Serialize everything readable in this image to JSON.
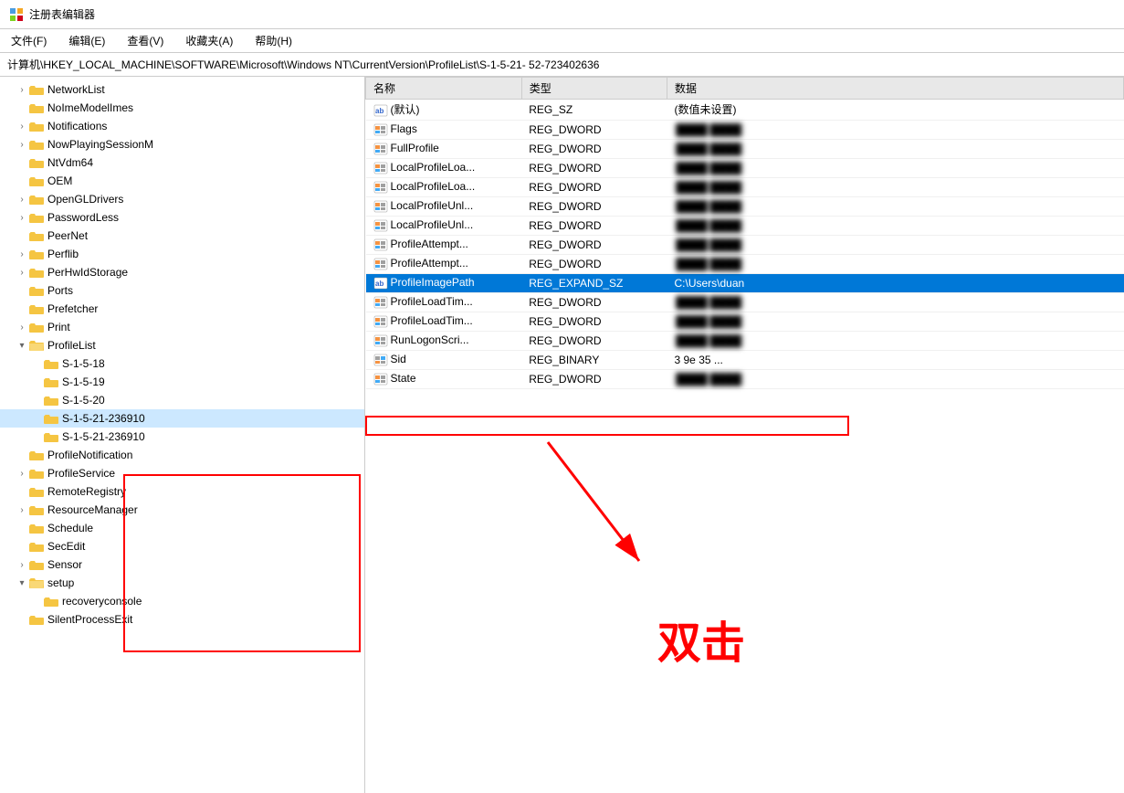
{
  "window": {
    "title": "注册表编辑器"
  },
  "menu": {
    "items": [
      "文件(F)",
      "编辑(E)",
      "查看(V)",
      "收藏夹(A)",
      "帮助(H)"
    ]
  },
  "address": {
    "path": "计算机\\HKEY_LOCAL_MACHINE\\SOFTWARE\\Microsoft\\Windows NT\\CurrentVersion\\ProfileList\\S-1-5-21-                    52-723402636"
  },
  "tree": {
    "items": [
      {
        "id": "networkList",
        "label": "NetworkList",
        "indent": 1,
        "expanded": false,
        "hasChildren": true
      },
      {
        "id": "noImeModelImes",
        "label": "NoImeModelImes",
        "indent": 1,
        "expanded": false,
        "hasChildren": false
      },
      {
        "id": "notifications",
        "label": "Notifications",
        "indent": 1,
        "expanded": false,
        "hasChildren": true
      },
      {
        "id": "nowPlayingSessionM",
        "label": "NowPlayingSessionM",
        "indent": 1,
        "expanded": false,
        "hasChildren": true
      },
      {
        "id": "ntVdm64",
        "label": "NtVdm64",
        "indent": 1,
        "expanded": false,
        "hasChildren": false
      },
      {
        "id": "oem",
        "label": "OEM",
        "indent": 1,
        "expanded": false,
        "hasChildren": false
      },
      {
        "id": "openGLDrivers",
        "label": "OpenGLDrivers",
        "indent": 1,
        "expanded": false,
        "hasChildren": true
      },
      {
        "id": "passwordLess",
        "label": "PasswordLess",
        "indent": 1,
        "expanded": false,
        "hasChildren": true
      },
      {
        "id": "peerNet",
        "label": "PeerNet",
        "indent": 1,
        "expanded": false,
        "hasChildren": false
      },
      {
        "id": "perflib",
        "label": "Perflib",
        "indent": 1,
        "expanded": false,
        "hasChildren": true
      },
      {
        "id": "perHwIdStorage",
        "label": "PerHwIdStorage",
        "indent": 1,
        "expanded": false,
        "hasChildren": true
      },
      {
        "id": "ports",
        "label": "Ports",
        "indent": 1,
        "expanded": false,
        "hasChildren": false
      },
      {
        "id": "prefetcher",
        "label": "Prefetcher",
        "indent": 1,
        "expanded": false,
        "hasChildren": false
      },
      {
        "id": "print",
        "label": "Print",
        "indent": 1,
        "expanded": false,
        "hasChildren": true
      },
      {
        "id": "profileList",
        "label": "ProfileList",
        "indent": 1,
        "expanded": true,
        "hasChildren": true,
        "boxed": true
      },
      {
        "id": "s1518",
        "label": "S-1-5-18",
        "indent": 2,
        "expanded": false,
        "hasChildren": false
      },
      {
        "id": "s1519",
        "label": "S-1-5-19",
        "indent": 2,
        "expanded": false,
        "hasChildren": false
      },
      {
        "id": "s1520",
        "label": "S-1-5-20",
        "indent": 2,
        "expanded": false,
        "hasChildren": false
      },
      {
        "id": "s152121",
        "label": "S-1-5-21-236910",
        "indent": 2,
        "expanded": false,
        "hasChildren": false,
        "selected": true
      },
      {
        "id": "s152122",
        "label": "S-1-5-21-236910",
        "indent": 2,
        "expanded": false,
        "hasChildren": false
      },
      {
        "id": "profileNotification",
        "label": "ProfileNotification",
        "indent": 1,
        "expanded": false,
        "hasChildren": false
      },
      {
        "id": "profileService",
        "label": "ProfileService",
        "indent": 1,
        "expanded": false,
        "hasChildren": true
      },
      {
        "id": "remoteRegistry",
        "label": "RemoteRegistry",
        "indent": 1,
        "expanded": false,
        "hasChildren": false
      },
      {
        "id": "resourceManager",
        "label": "ResourceManager",
        "indent": 1,
        "expanded": false,
        "hasChildren": true
      },
      {
        "id": "schedule",
        "label": "Schedule",
        "indent": 1,
        "expanded": false,
        "hasChildren": false
      },
      {
        "id": "secEdit",
        "label": "SecEdit",
        "indent": 1,
        "expanded": false,
        "hasChildren": false
      },
      {
        "id": "sensor",
        "label": "Sensor",
        "indent": 1,
        "expanded": false,
        "hasChildren": true
      },
      {
        "id": "setup",
        "label": "setup",
        "indent": 1,
        "expanded": true,
        "hasChildren": true
      },
      {
        "id": "recoveryConsole",
        "label": "recoveryconsole",
        "indent": 2,
        "expanded": false,
        "hasChildren": false
      },
      {
        "id": "silentProcessExit",
        "label": "SilentProcessExit",
        "indent": 1,
        "expanded": false,
        "hasChildren": false
      }
    ]
  },
  "table": {
    "columns": [
      "名称",
      "类型",
      "数据"
    ],
    "rows": [
      {
        "name": "(默认)",
        "type": "REG_SZ",
        "data": "(数值未设置)",
        "icon": "ab",
        "highlighted": false
      },
      {
        "name": "Flags",
        "type": "REG_DWORD",
        "data": "BLURRED_0",
        "icon": "dword",
        "highlighted": false
      },
      {
        "name": "FullProfile",
        "type": "REG_DWORD",
        "data": "BLURRED_1",
        "icon": "dword",
        "highlighted": false
      },
      {
        "name": "LocalProfileLoa...",
        "type": "REG_DWORD",
        "data": "BLURRED_2",
        "icon": "dword",
        "highlighted": false
      },
      {
        "name": "LocalProfileLoa...",
        "type": "REG_DWORD",
        "data": "BLURRED_3",
        "icon": "dword",
        "highlighted": false
      },
      {
        "name": "LocalProfileUnl...",
        "type": "REG_DWORD",
        "data": "BLURRED_4",
        "icon": "dword",
        "highlighted": false
      },
      {
        "name": "LocalProfileUnl...",
        "type": "REG_DWORD",
        "data": "BLURRED_5",
        "icon": "dword",
        "highlighted": false
      },
      {
        "name": "ProfileAttempt...",
        "type": "REG_DWORD",
        "data": "BLURRED_6",
        "icon": "dword",
        "highlighted": false
      },
      {
        "name": "ProfileAttempt...",
        "type": "REG_DWORD",
        "data": "BLURRED_7",
        "icon": "dword",
        "highlighted": false
      },
      {
        "name": "ProfileImagePath",
        "type": "REG_EXPAND_SZ",
        "data": "C:\\Users\\duan",
        "icon": "ab",
        "highlighted": true,
        "selected": true
      },
      {
        "name": "ProfileLoadTim...",
        "type": "REG_DWORD",
        "data": "BLURRED_8",
        "icon": "dword",
        "highlighted": false
      },
      {
        "name": "ProfileLoadTim...",
        "type": "REG_DWORD",
        "data": "BLURRED_9",
        "icon": "dword",
        "highlighted": false
      },
      {
        "name": "RunLogonScri...",
        "type": "REG_DWORD",
        "data": "BLURRED_10",
        "icon": "dword",
        "highlighted": false
      },
      {
        "name": "Sid",
        "type": "REG_BINARY",
        "data": "3 9e 35 ...",
        "icon": "binary",
        "highlighted": false
      },
      {
        "name": "State",
        "type": "REG_DWORD",
        "data": "BLURRED_11",
        "icon": "dword",
        "highlighted": false
      }
    ]
  },
  "annotation": {
    "double_click_text": "双击"
  }
}
